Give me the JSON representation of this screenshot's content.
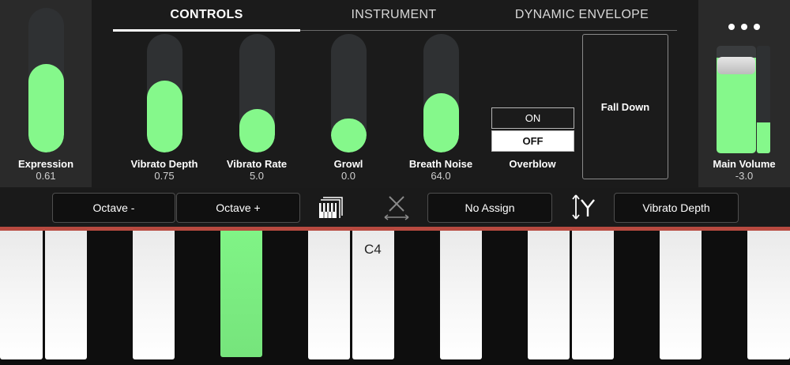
{
  "tabs": [
    {
      "label": "CONTROLS",
      "active": true
    },
    {
      "label": "INSTRUMENT",
      "active": false
    },
    {
      "label": "DYNAMIC ENVELOPE",
      "active": false
    }
  ],
  "sliders": {
    "expression": {
      "label": "Expression",
      "value": "0.61",
      "level": 0.61
    },
    "vibrato_depth": {
      "label": "Vibrato Depth",
      "value": "0.75",
      "level": 0.61
    },
    "vibrato_rate": {
      "label": "Vibrato Rate",
      "value": "5.0",
      "level": 0.37
    },
    "growl": {
      "label": "Growl",
      "value": "0.0",
      "level": 0.29
    },
    "breath_noise": {
      "label": "Breath Noise",
      "value": "64.0",
      "level": 0.5
    }
  },
  "overblow": {
    "label": "Overblow",
    "on_label": "ON",
    "off_label": "OFF",
    "selected": "OFF"
  },
  "fall_down": {
    "label": "Fall Down"
  },
  "main_volume": {
    "label": "Main Volume",
    "value": "-3.0",
    "level": 0.89,
    "meter_level": 0.29
  },
  "toolbar": {
    "octave_minus": "Octave -",
    "octave_plus": "Octave +",
    "x_assign": "No Assign",
    "y_assign": "Vibrato Depth"
  },
  "keyboard": {
    "c4_label": "C4",
    "pressed_key": "A3"
  },
  "icons": {
    "menu": "more-dots-icon",
    "keyboard": "keyboard-icon",
    "x_axis": "x-axis-icon",
    "y_axis": "y-axis-icon"
  },
  "colors": {
    "accent": "#85f88b",
    "track": "#2f3133",
    "panel": "#2a2a2a",
    "keyboard_strip": "#b84a40"
  }
}
